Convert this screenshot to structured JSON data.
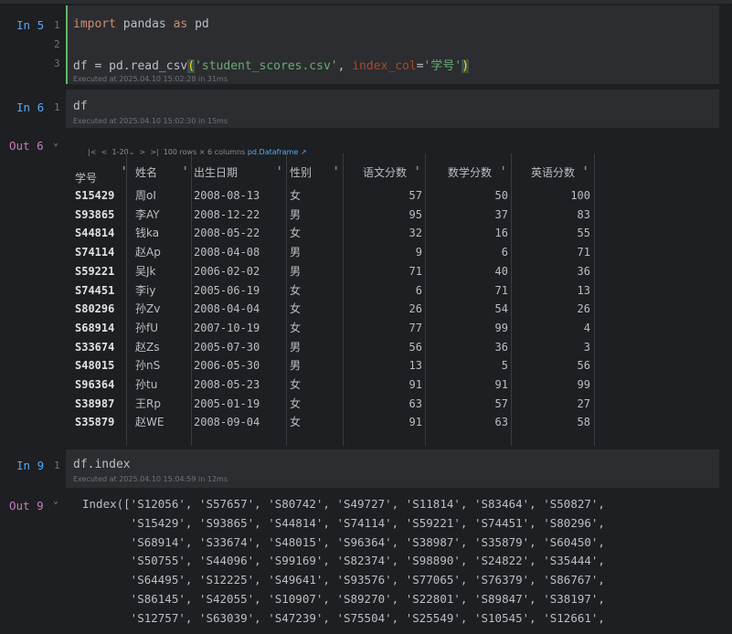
{
  "cells": {
    "in5": {
      "prompt": "In 5",
      "lines": [
        "1",
        "2",
        "3"
      ],
      "line1": {
        "kw_import": "import",
        "mod": " pandas ",
        "kw_as": "as",
        "alias": " pd"
      },
      "line3": {
        "lhs": "df = pd.read_csv",
        "open": "(",
        "str1": "'student_scores.csv'",
        "comma": ", ",
        "kwarg": "index_col",
        "eq": "=",
        "str2": "'学号'",
        "close": ")"
      },
      "exec": "Executed at 2025.04.10 15:02:28 in 31ms"
    },
    "in6": {
      "prompt": "In 6",
      "line": "1",
      "code": "df",
      "exec": "Executed at 2025.04.10 15:02:30 in 15ms"
    },
    "out6": {
      "prompt": "Out 6",
      "chevron": "⌄",
      "pager": {
        "first": "|<",
        "prev": "<",
        "range": "1-20",
        "range_chev": "⌄",
        "next": ">",
        "last": ">|",
        "summary": "100 rows × 6 columns",
        "type_link": "pd.Dataframe ↗"
      },
      "columns": [
        "学号",
        "姓名",
        "出生日期",
        "性别",
        "语文分数",
        "数学分数",
        "英语分数"
      ],
      "sort_glyph": "⬍",
      "rows": [
        [
          "S15429",
          "周oI",
          "2008-08-13",
          "女",
          "57",
          "50",
          "100"
        ],
        [
          "S93865",
          "李AY",
          "2008-12-22",
          "男",
          "95",
          "37",
          "83"
        ],
        [
          "S44814",
          "钱ka",
          "2008-05-22",
          "女",
          "32",
          "16",
          "55"
        ],
        [
          "S74114",
          "赵Ap",
          "2008-04-08",
          "男",
          "9",
          "6",
          "71"
        ],
        [
          "S59221",
          "吴Jk",
          "2006-02-02",
          "男",
          "71",
          "40",
          "36"
        ],
        [
          "S74451",
          "李iy",
          "2005-06-19",
          "女",
          "6",
          "71",
          "13"
        ],
        [
          "S80296",
          "孙Zv",
          "2008-04-04",
          "女",
          "26",
          "54",
          "26"
        ],
        [
          "S68914",
          "孙fU",
          "2007-10-19",
          "女",
          "77",
          "99",
          "4"
        ],
        [
          "S33674",
          "赵Zs",
          "2005-07-30",
          "男",
          "56",
          "36",
          "3"
        ],
        [
          "S48015",
          "孙nS",
          "2006-05-30",
          "男",
          "13",
          "5",
          "56"
        ],
        [
          "S96364",
          "孙tu",
          "2008-05-23",
          "女",
          "91",
          "91",
          "99"
        ],
        [
          "S38987",
          "王Rp",
          "2005-01-19",
          "女",
          "63",
          "57",
          "27"
        ],
        [
          "S35879",
          "赵WE",
          "2008-09-04",
          "女",
          "91",
          "63",
          "58"
        ]
      ]
    },
    "in9": {
      "prompt": "In 9",
      "line": "1",
      "code": "df.index",
      "exec": "Executed at 2025.04.10 15:04:59 in 12ms"
    },
    "out9": {
      "prompt": "Out 9",
      "chevron": "⌄",
      "lines": [
        "Index(['S12056', 'S57657', 'S80742', 'S49727', 'S11814', 'S83464', 'S50827',",
        "       'S15429', 'S93865', 'S44814', 'S74114', 'S59221', 'S74451', 'S80296',",
        "       'S68914', 'S33674', 'S48015', 'S96364', 'S38987', 'S35879', 'S60450',",
        "       'S50755', 'S44096', 'S99169', 'S82374', 'S98890', 'S24822', 'S35444',",
        "       'S64495', 'S12225', 'S49641', 'S93576', 'S77065', 'S76379', 'S86767',",
        "       'S86145', 'S42055', 'S10907', 'S89270', 'S22801', 'S89847', 'S38197',",
        "       'S12757', 'S63039', 'S47239', 'S75504', 'S25549', 'S10545', 'S12661',"
      ]
    }
  }
}
